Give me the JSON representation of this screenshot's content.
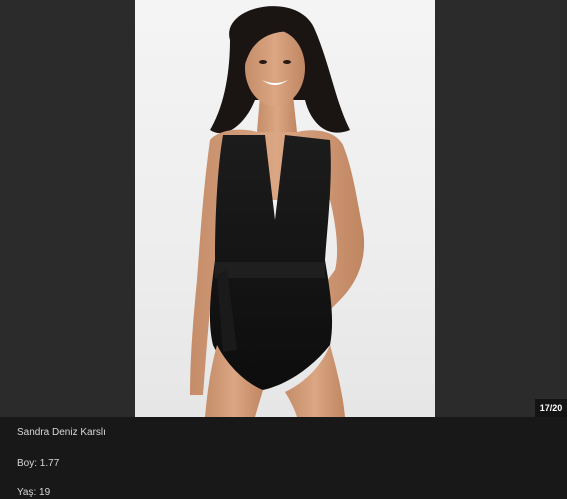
{
  "gallery": {
    "counter": "17/20",
    "image_alt": "Sandra Deniz Karslı",
    "caption": {
      "name": "Sandra Deniz Karslı",
      "height": "Boy: 1.77",
      "age": "Yaş: 19"
    }
  },
  "colors": {
    "background": "#2b2b2b",
    "caption_background": "#181818",
    "badge_background": "#141414"
  }
}
